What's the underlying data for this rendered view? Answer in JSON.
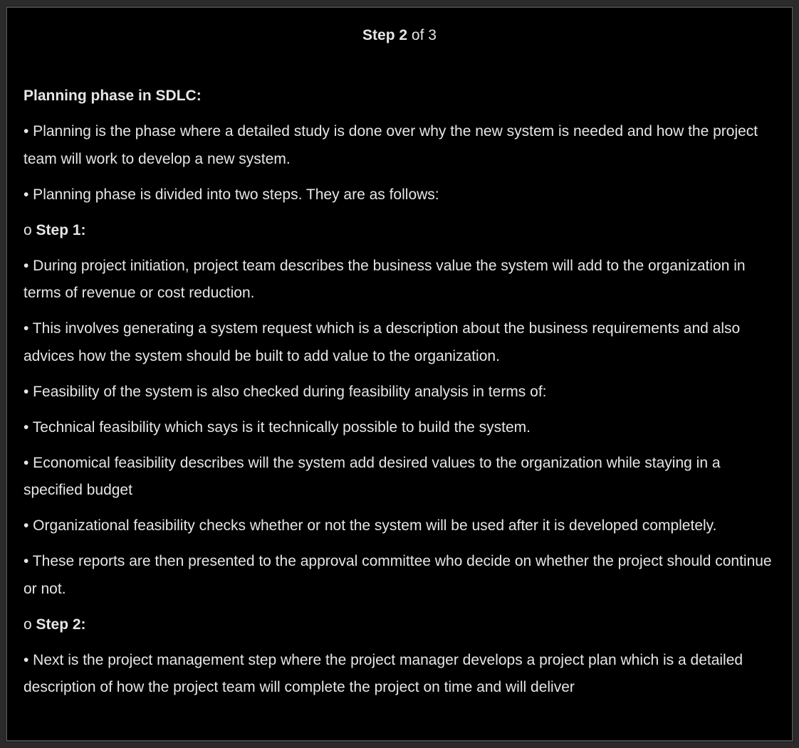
{
  "header": {
    "step_word": "Step",
    "step_number": "2",
    "of_total": " of 3"
  },
  "content": {
    "heading": "Planning phase in SDLC:",
    "p1": "• Planning is the phase where a detailed study is done over why the new system is needed and how the project team will work to develop a new system.",
    "p2": "• Planning phase is divided into two steps. They are as follows:",
    "step1_prefix": "o ",
    "step1_label": "Step 1:",
    "p3": "• During project initiation, project team describes the business value the system will add to the organization in terms of revenue or cost reduction.",
    "p4": "• This involves generating a system request which is a description about the business requirements and also advices how the system should be built to add value to the organization.",
    "p5": "• Feasibility of the system is also checked during feasibility analysis in terms of:",
    "p6": "• Technical feasibility which says is it technically possible to build the system.",
    "p7": "• Economical feasibility describes will the system add desired values to the organization while staying in a specified budget",
    "p8": "• Organizational feasibility checks whether or not the system will be used after it is developed completely.",
    "p9": "• These reports are then presented to the approval committee who decide on whether the project should continue or not.",
    "step2_prefix": "o ",
    "step2_label": "Step 2:",
    "p10": "• Next is the project management step where the project manager develops a project plan which is a detailed description of how the project team will complete the project on time and will deliver"
  }
}
